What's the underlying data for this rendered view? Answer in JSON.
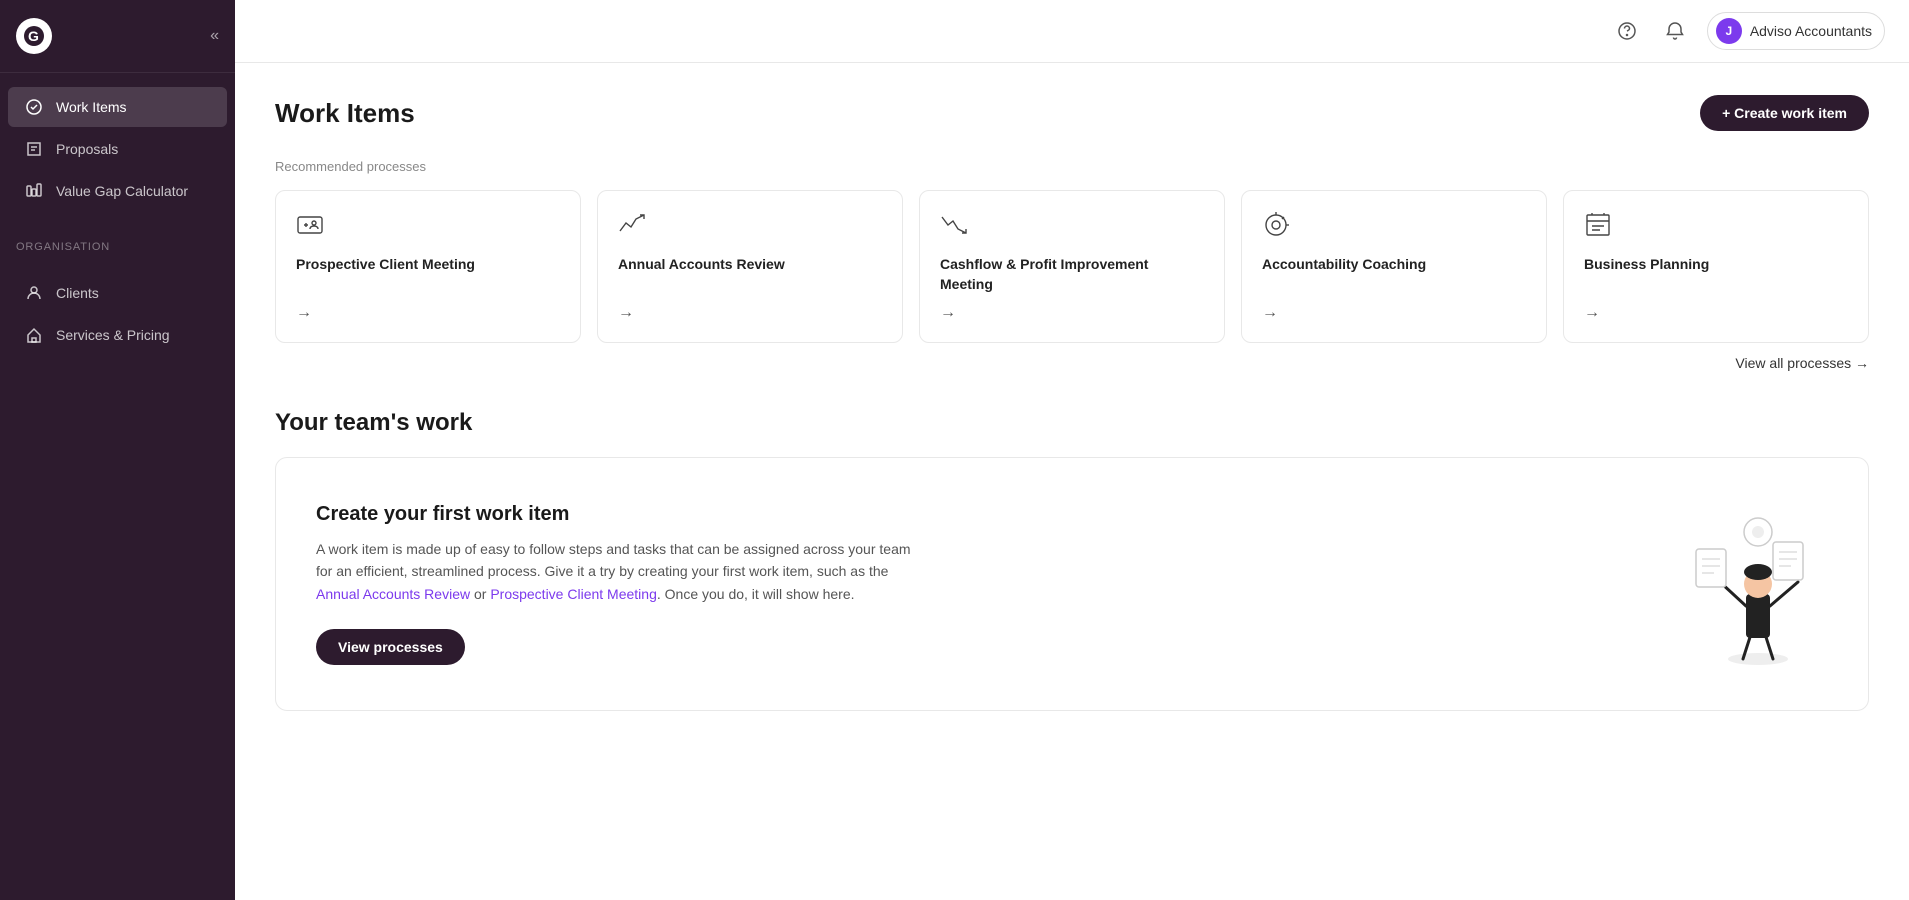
{
  "sidebar": {
    "logo_text": "G",
    "nav_items": [
      {
        "id": "work-items",
        "label": "Work Items",
        "active": true
      },
      {
        "id": "proposals",
        "label": "Proposals",
        "active": false
      },
      {
        "id": "value-gap-calculator",
        "label": "Value Gap Calculator",
        "active": false
      }
    ],
    "org_section_label": "Organisation",
    "org_items": [
      {
        "id": "clients",
        "label": "Clients"
      },
      {
        "id": "services-pricing",
        "label": "Services & Pricing"
      }
    ]
  },
  "topbar": {
    "user_name": "Adviso Accountants",
    "user_initial": "J"
  },
  "page": {
    "title": "Work Items",
    "create_button_label": "+ Create work item"
  },
  "recommended_processes": {
    "section_label": "Recommended processes",
    "cards": [
      {
        "id": "prospective-client-meeting",
        "name": "Prospective Client Meeting",
        "icon": "👥"
      },
      {
        "id": "annual-accounts-review",
        "name": "Annual Accounts Review",
        "icon": "📈"
      },
      {
        "id": "cashflow-profit-meeting",
        "name": "Cashflow & Profit Improvement Meeting",
        "icon": "📉"
      },
      {
        "id": "accountability-coaching",
        "name": "Accountability Coaching",
        "icon": "🎯"
      },
      {
        "id": "business-planning",
        "name": "Business Planning",
        "icon": "🗺️"
      }
    ],
    "view_all_label": "View all processes →"
  },
  "team_work": {
    "title": "Your team's work",
    "empty_state": {
      "title": "Create your first work item",
      "description_1": "A work item is made up of easy to follow steps and tasks that can be assigned across your team for an efficient, streamlined process. Give it a try by creating your first work item, such as the Annual Accounts Review or Prospective Client Meeting. Once you do, it will show here.",
      "view_processes_btn": "View processes"
    }
  }
}
